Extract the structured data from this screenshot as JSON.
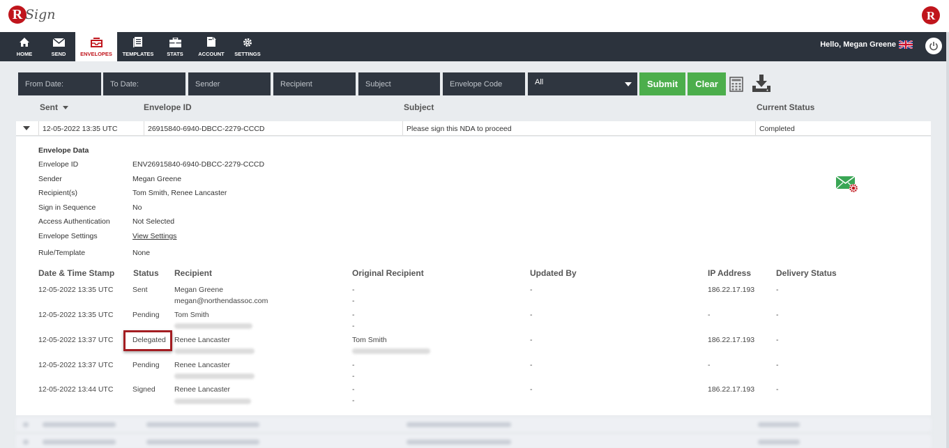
{
  "brand": {
    "logo_letter": "R",
    "logo_text": "Sign"
  },
  "nav": {
    "items": [
      {
        "label": "HOME",
        "icon": "home-icon"
      },
      {
        "label": "SEND",
        "icon": "envelope-icon"
      },
      {
        "label": "ENVELOPES",
        "icon": "inbox-icon"
      },
      {
        "label": "TEMPLATES",
        "icon": "book-icon"
      },
      {
        "label": "STATS",
        "icon": "briefcase-icon"
      },
      {
        "label": "ACCOUNT",
        "icon": "document-icon"
      },
      {
        "label": "SETTINGS",
        "icon": "gear-icon"
      }
    ],
    "active": "ENVELOPES",
    "greeting": "Hello, Megan Greene"
  },
  "filters": {
    "from_date": "From Date:",
    "to_date": "To Date:",
    "sender": "Sender",
    "recipient": "Recipient",
    "subject": "Subject",
    "envelope_code": "Envelope Code",
    "status_select": "All",
    "submit": "Submit",
    "clear": "Clear"
  },
  "table": {
    "headers": {
      "sent": "Sent",
      "envelope_id": "Envelope ID",
      "subject": "Subject",
      "status": "Current Status"
    },
    "row": {
      "sent": "12-05-2022 13:35 UTC",
      "envelope_id": "26915840-6940-DBCC-2279-CCCD",
      "subject": "Please sign this NDA to proceed",
      "status": "Completed"
    }
  },
  "envelope_data": {
    "title": "Envelope Data",
    "fields": [
      {
        "label": "Envelope ID",
        "value": "ENV26915840-6940-DBCC-2279-CCCD"
      },
      {
        "label": "Sender",
        "value": "Megan Greene"
      },
      {
        "label": "Recipient(s)",
        "value": "Tom Smith, Renee Lancaster"
      },
      {
        "label": "Sign in Sequence",
        "value": "No"
      },
      {
        "label": "Access Authentication",
        "value": "Not Selected"
      },
      {
        "label": "Envelope Settings",
        "value": "View Settings"
      },
      {
        "label": "Rule/Template",
        "value": "None"
      }
    ]
  },
  "history": {
    "headers": {
      "timestamp": "Date & Time Stamp",
      "status": "Status",
      "recipient": "Recipient",
      "original": "Original Recipient",
      "updated_by": "Updated By",
      "ip": "IP Address",
      "delivery": "Delivery Status"
    },
    "rows": [
      {
        "timestamp": "12-05-2022 13:35 UTC",
        "status": "Sent",
        "recipient": "Megan Greene",
        "email": "megan@northendassoc.com",
        "original": "-",
        "original2": "-",
        "updated_by": "-",
        "ip": "186.22.17.193",
        "delivery": "-"
      },
      {
        "timestamp": "12-05-2022 13:35 UTC",
        "status": "Pending",
        "recipient": "Tom Smith",
        "original": "-",
        "original2": "-",
        "updated_by": "-",
        "ip": "-",
        "delivery": "-"
      },
      {
        "timestamp": "12-05-2022 13:37 UTC",
        "status": "Delegated",
        "recipient": "Renee Lancaster",
        "original": "Tom Smith",
        "updated_by": "-",
        "ip": "186.22.17.193",
        "delivery": "-"
      },
      {
        "timestamp": "12-05-2022 13:37 UTC",
        "status": "Pending",
        "recipient": "Renee Lancaster",
        "original": "-",
        "original2": "-",
        "updated_by": "-",
        "ip": "-",
        "delivery": "-"
      },
      {
        "timestamp": "12-05-2022 13:44 UTC",
        "status": "Signed",
        "recipient": "Renee Lancaster",
        "original": "-",
        "original2": "-",
        "updated_by": "-",
        "ip": "186.22.17.193",
        "delivery": "-"
      }
    ]
  },
  "colors": {
    "brand_red": "#c0151c",
    "nav_bg": "#2c333d",
    "green": "#4cae4c",
    "highlight": "#a31d22"
  }
}
